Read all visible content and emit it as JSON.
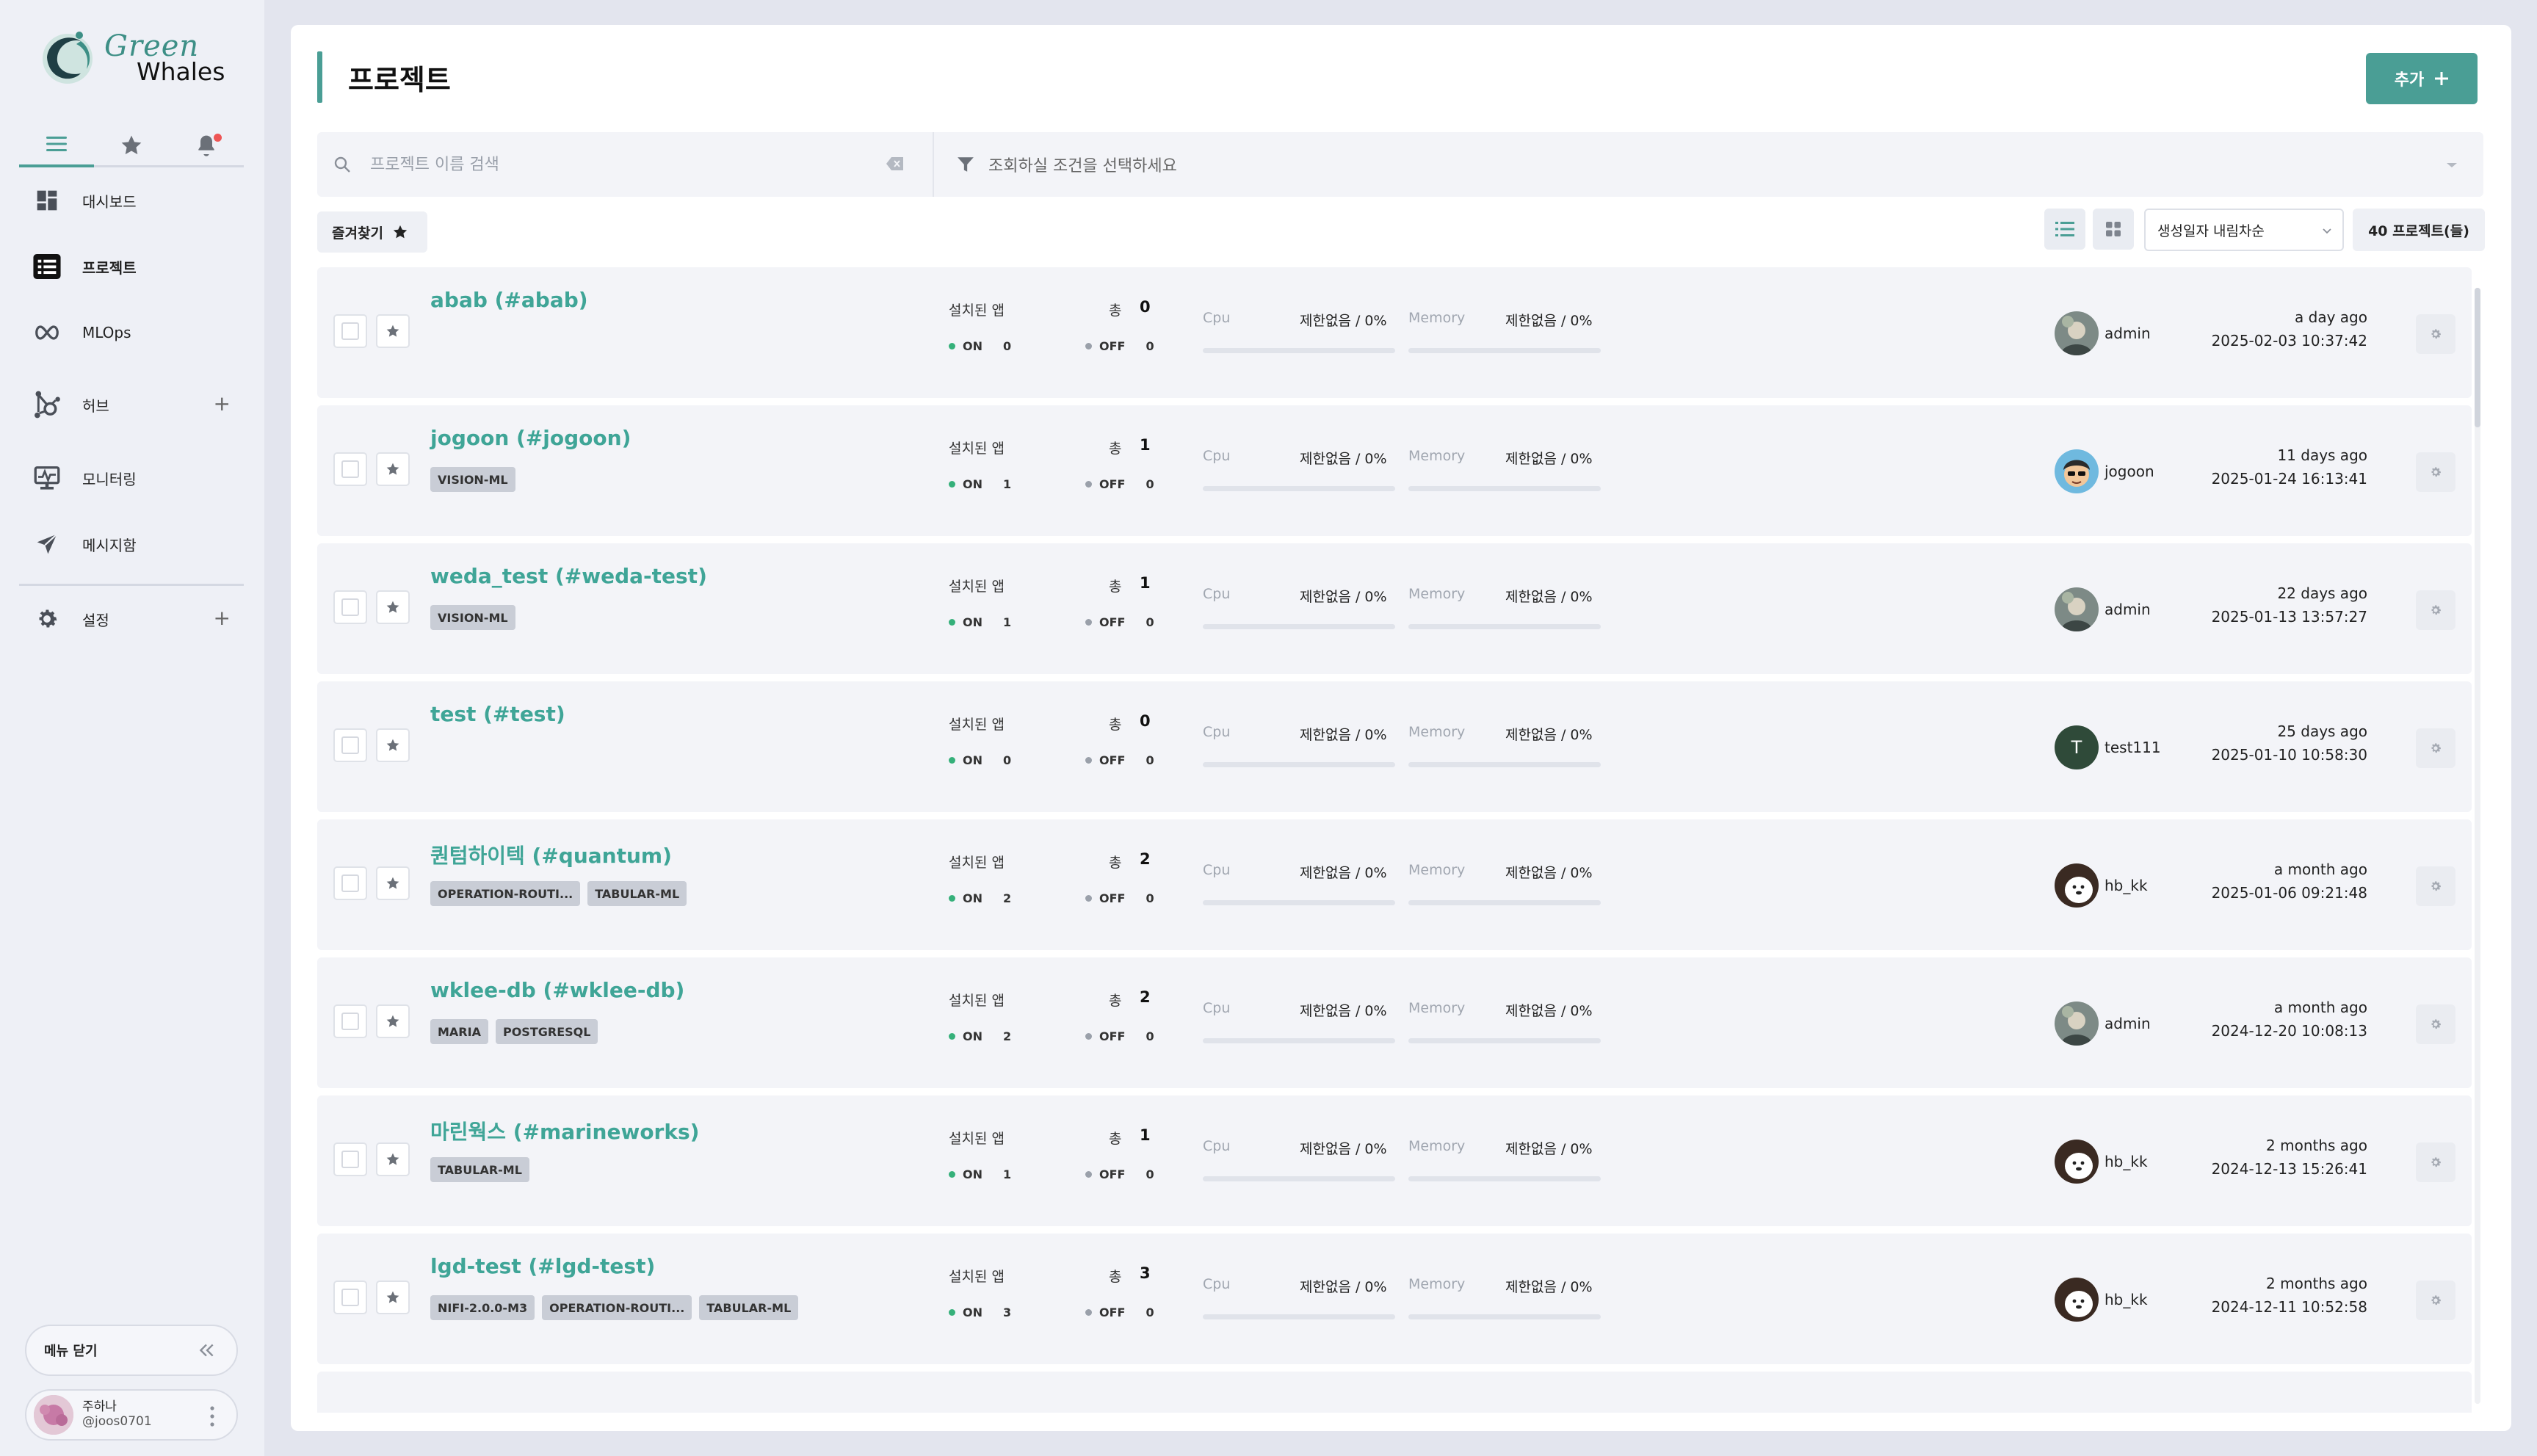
{
  "brand": {
    "name_top": "Green",
    "name_bottom": "Whales",
    "accent": "#4a9e95"
  },
  "sidebar": {
    "tabs": [
      "menu-icon",
      "star-icon",
      "bell-icon"
    ],
    "items": [
      {
        "label": "대시보드",
        "icon": "dashboard-icon"
      },
      {
        "label": "프로젝트",
        "icon": "list-icon",
        "active": true
      },
      {
        "label": "MLOps",
        "icon": "infinity-icon"
      },
      {
        "label": "허브",
        "icon": "hub-icon",
        "plus": "+"
      },
      {
        "label": "모니터링",
        "icon": "monitor-icon"
      },
      {
        "label": "메시지함",
        "icon": "send-icon"
      },
      {
        "label": "설정",
        "icon": "gear-icon",
        "plus": "+"
      }
    ],
    "close_menu": "메뉴 닫기",
    "user": {
      "name": "주하나",
      "id": "@joos0701"
    }
  },
  "header": {
    "title": "프로젝트",
    "add_label": "추가"
  },
  "search": {
    "placeholder": "프로젝트 이름 검색",
    "filter_placeholder": "조회하실 조건을 선택하세요"
  },
  "toolbar": {
    "favorites": "즐겨찾기",
    "sort": "생성일자 내림차순",
    "count": "40 프로젝트(들)"
  },
  "labels": {
    "installed_apps": "설치된 앱",
    "total": "총",
    "on": "ON",
    "off": "OFF",
    "cpu": "Cpu",
    "memory": "Memory"
  },
  "projects": [
    {
      "name": "abab (#abab)",
      "tags": [],
      "total": "0",
      "on": "0",
      "off": "0",
      "cpu": "제한없음 / 0%",
      "memory": "제한없음 / 0%",
      "owner": "admin",
      "ago": "a day ago",
      "date": "2025-02-03 10:37:42"
    },
    {
      "name": "jogoon (#jogoon)",
      "tags": [
        "VISION-ML"
      ],
      "total": "1",
      "on": "1",
      "off": "0",
      "cpu": "제한없음 / 0%",
      "memory": "제한없음 / 0%",
      "owner": "jogoon",
      "ago": "11 days ago",
      "date": "2025-01-24 16:13:41"
    },
    {
      "name": "weda_test (#weda-test)",
      "tags": [
        "VISION-ML"
      ],
      "total": "1",
      "on": "1",
      "off": "0",
      "cpu": "제한없음 / 0%",
      "memory": "제한없음 / 0%",
      "owner": "admin",
      "ago": "22 days ago",
      "date": "2025-01-13 13:57:27"
    },
    {
      "name": "test (#test)",
      "tags": [],
      "total": "0",
      "on": "0",
      "off": "0",
      "cpu": "제한없음 / 0%",
      "memory": "제한없음 / 0%",
      "owner": "test111",
      "avatar_letter": "T",
      "ago": "25 days ago",
      "date": "2025-01-10 10:58:30"
    },
    {
      "name": "퀀텀하이텍 (#quantum)",
      "tags": [
        "OPERATION-ROUTI...",
        "TABULAR-ML"
      ],
      "total": "2",
      "on": "2",
      "off": "0",
      "cpu": "제한없음 / 0%",
      "memory": "제한없음 / 0%",
      "owner": "hb_kk",
      "ago": "a month ago",
      "date": "2025-01-06 09:21:48"
    },
    {
      "name": "wklee-db (#wklee-db)",
      "tags": [
        "MARIA",
        "POSTGRESQL"
      ],
      "total": "2",
      "on": "2",
      "off": "0",
      "cpu": "제한없음 / 0%",
      "memory": "제한없음 / 0%",
      "owner": "admin",
      "ago": "a month ago",
      "date": "2024-12-20 10:08:13"
    },
    {
      "name": "마린웍스 (#marineworks)",
      "tags": [
        "TABULAR-ML"
      ],
      "total": "1",
      "on": "1",
      "off": "0",
      "cpu": "제한없음 / 0%",
      "memory": "제한없음 / 0%",
      "owner": "hb_kk",
      "ago": "2 months ago",
      "date": "2024-12-13 15:26:41"
    },
    {
      "name": "lgd-test (#lgd-test)",
      "tags": [
        "NIFI-2.0.0-M3",
        "OPERATION-ROUTI...",
        "TABULAR-ML"
      ],
      "total": "3",
      "on": "3",
      "off": "0",
      "cpu": "제한없음 / 0%",
      "memory": "제한없음 / 0%",
      "owner": "hb_kk",
      "ago": "2 months ago",
      "date": "2024-12-11 10:52:58"
    }
  ]
}
